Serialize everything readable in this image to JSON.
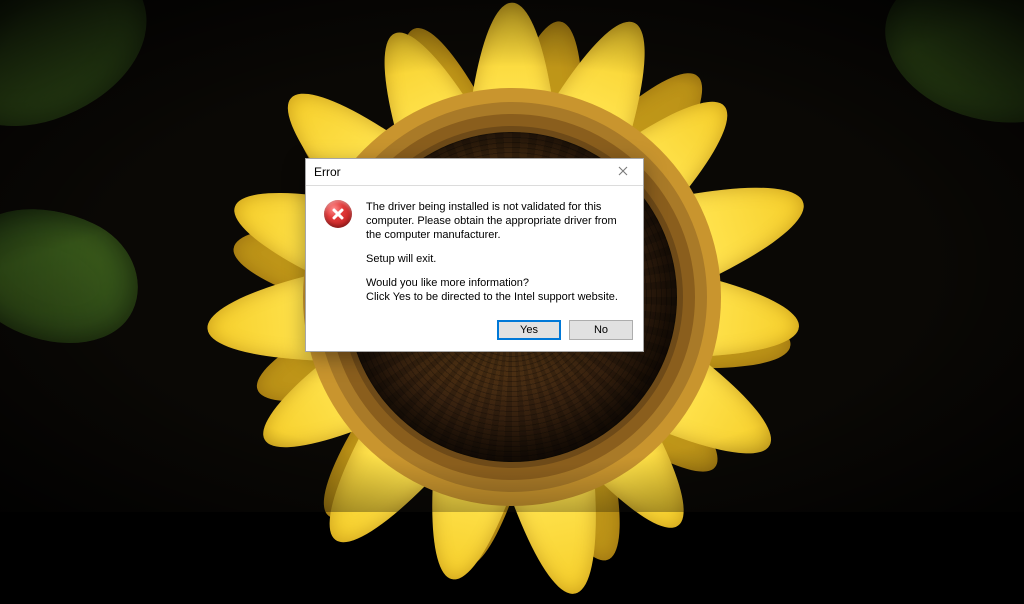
{
  "dialog": {
    "title": "Error",
    "close_label": "Close",
    "paragraph1": "The driver being installed is not validated for this computer. Please obtain the appropriate driver from the computer manufacturer.",
    "paragraph2": "Setup will exit.",
    "paragraph3_line1": "Would you like more information?",
    "paragraph3_line2": "Click Yes to be directed to the Intel support website.",
    "yes_label": "Yes",
    "no_label": "No"
  }
}
